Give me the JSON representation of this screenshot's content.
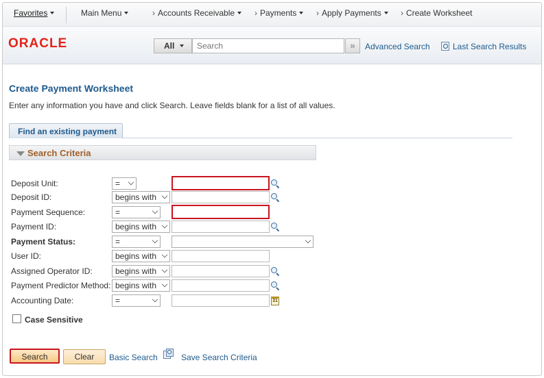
{
  "nav": {
    "favorites": "Favorites",
    "main_menu": "Main Menu",
    "breadcrumbs": [
      {
        "label": "Accounts Receivable"
      },
      {
        "label": "Payments"
      },
      {
        "label": "Apply Payments"
      },
      {
        "label": "Create Worksheet"
      }
    ]
  },
  "header": {
    "logo": "ORACLE",
    "search_scope": "All",
    "search_placeholder": "Search",
    "search_go": "»",
    "advanced_search": "Advanced Search",
    "last_search_results": "Last Search Results"
  },
  "page": {
    "title": "Create Payment Worksheet",
    "instructions": "Enter any information you have and click Search. Leave fields blank for a list of all values.",
    "tab": "Find an existing payment",
    "section": "Search Criteria"
  },
  "fields": [
    {
      "label": "Deposit Unit:",
      "operator": "=",
      "bold": false,
      "required": true,
      "lookup": true
    },
    {
      "label": "Deposit ID:",
      "operator": "begins with",
      "bold": false,
      "required": false,
      "lookup": true
    },
    {
      "label": "Payment Sequence:",
      "operator": "=",
      "bold": false,
      "required": true,
      "lookup": false
    },
    {
      "label": "Payment ID:",
      "operator": "begins with",
      "bold": false,
      "required": false,
      "lookup": true
    },
    {
      "label": "Payment Status:",
      "operator": "=",
      "bold": true,
      "required": false,
      "lookup": false
    },
    {
      "label": "User ID:",
      "operator": "begins with",
      "bold": false,
      "required": false,
      "lookup": false
    },
    {
      "label": "Assigned Operator ID:",
      "operator": "begins with",
      "bold": false,
      "required": false,
      "lookup": true
    },
    {
      "label": "Payment Predictor Method:",
      "operator": "begins with",
      "bold": false,
      "required": false,
      "lookup": true
    },
    {
      "label": "Accounting Date:",
      "operator": "=",
      "bold": false,
      "required": false,
      "lookup": false
    }
  ],
  "case_sensitive": "Case Sensitive",
  "calendar_day": "31",
  "buttons": {
    "search": "Search",
    "clear": "Clear",
    "basic_search": "Basic Search",
    "save_search": "Save Search Criteria"
  },
  "colors": {
    "link": "#1d5a8c",
    "required_border": "#c8141e",
    "section_title": "#a0602a",
    "logo": "#e2231a"
  }
}
